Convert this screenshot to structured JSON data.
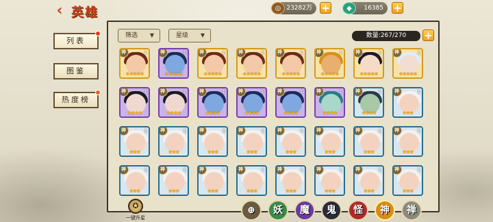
{
  "header": {
    "title": "英雄",
    "back_icon": "chevron-left-icon"
  },
  "currency": {
    "coins": "23282万",
    "jade": "16385",
    "plus_label": "+"
  },
  "sidebar": {
    "items": [
      {
        "label": "列表",
        "active": true,
        "badge": true
      },
      {
        "label": "图鉴",
        "active": false,
        "badge": false
      },
      {
        "label": "热度榜",
        "active": false,
        "badge": true
      }
    ]
  },
  "toolbar": {
    "filter_label": "筛选",
    "sort_label": "星级",
    "count_label": "数量:267/270",
    "add_label": "+"
  },
  "grid": {
    "badge_text": "神",
    "rows": [
      [
        {
          "level": "1",
          "frame": "gold",
          "hair": "#6b2a1a",
          "face": "#f3c9a8",
          "stars": "★★★★★"
        },
        {
          "level": "1",
          "frame": "purple",
          "hair": "#1b2a5a",
          "face": "#7fa8e0",
          "stars": "★★★★★"
        },
        {
          "level": "1",
          "frame": "gold",
          "hair": "#6b2a1a",
          "face": "#f3c9a8",
          "stars": "★★★★★"
        },
        {
          "level": "1",
          "frame": "gold",
          "hair": "#6b2a1a",
          "face": "#f3c9a8",
          "stars": "★★★★★"
        },
        {
          "level": "1",
          "frame": "gold",
          "hair": "#6b2a1a",
          "face": "#f3c9a8",
          "stars": "★★★★★"
        },
        {
          "level": "1",
          "frame": "gold",
          "hair": "#d8901a",
          "face": "#e8b070",
          "stars": "★★★★★"
        },
        {
          "level": "1",
          "frame": "gold",
          "hair": "#1a1a2a",
          "face": "#f6dcc8",
          "stars": "★★★★★"
        },
        {
          "level": "1",
          "frame": "gold",
          "hair": "#e0eef8",
          "face": "#f3dcd0",
          "stars": "★★★★★"
        }
      ],
      [
        {
          "level": "1",
          "frame": "purple",
          "hair": "#1a1a22",
          "face": "#f0d8d0",
          "stars": "★★★★"
        },
        {
          "level": "1",
          "frame": "purple",
          "hair": "#1a1a22",
          "face": "#f0d8d0",
          "stars": "★★★★"
        },
        {
          "level": "1",
          "frame": "purple",
          "hair": "#1b2a5a",
          "face": "#7fa8e0",
          "stars": "★★★★"
        },
        {
          "level": "1",
          "frame": "purple",
          "hair": "#1b2a5a",
          "face": "#7fa8e0",
          "stars": "★★★★"
        },
        {
          "level": "1",
          "frame": "purple",
          "hair": "#1b2a5a",
          "face": "#7fa8e0",
          "stars": "★★★★"
        },
        {
          "level": "1",
          "frame": "purple",
          "hair": "#2a7a8a",
          "face": "#a8d8c8",
          "stars": "★★★★"
        },
        {
          "level": "1",
          "frame": "blue",
          "hair": "#2a3a4a",
          "face": "#a8c8a8",
          "stars": "★★★★"
        },
        {
          "level": "1",
          "frame": "blue",
          "hair": "#f2f2f2",
          "face": "#f3d3c0",
          "stars": "★★★"
        }
      ],
      [
        {
          "level": "1",
          "frame": "blue",
          "hair": "#f2f2f2",
          "face": "#f3d3c0",
          "stars": "★★★"
        },
        {
          "level": "1",
          "frame": "blue",
          "hair": "#f2f2f2",
          "face": "#f3d3c0",
          "stars": "★★★"
        },
        {
          "level": "1",
          "frame": "blue",
          "hair": "#f2f2f2",
          "face": "#f3d3c0",
          "stars": "★★★"
        },
        {
          "level": "1",
          "frame": "blue",
          "hair": "#f2f2f2",
          "face": "#f3d3c0",
          "stars": "★★★"
        },
        {
          "level": "1",
          "frame": "blue",
          "hair": "#f2f2f2",
          "face": "#f3d3c0",
          "stars": "★★★"
        },
        {
          "level": "1",
          "frame": "blue",
          "hair": "#f2f2f2",
          "face": "#f3d3c0",
          "stars": "★★★"
        },
        {
          "level": "1",
          "frame": "blue",
          "hair": "#f2f2f2",
          "face": "#f3d3c0",
          "stars": "★★★"
        },
        {
          "level": "1",
          "frame": "blue",
          "hair": "#f2f2f2",
          "face": "#f3d3c0",
          "stars": "★★★"
        }
      ],
      [
        {
          "level": "1",
          "frame": "blue",
          "hair": "#f2f2f2",
          "face": "#f3d3c0",
          "stars": "★★★"
        },
        {
          "level": "1",
          "frame": "blue",
          "hair": "#f2f2f2",
          "face": "#f3d3c0",
          "stars": "★★★"
        },
        {
          "level": "1",
          "frame": "blue",
          "hair": "#f2f2f2",
          "face": "#f3d3c0",
          "stars": "★★★"
        },
        {
          "level": "1",
          "frame": "blue",
          "hair": "#f2f2f2",
          "face": "#f3d3c0",
          "stars": "★★★"
        },
        {
          "level": "1",
          "frame": "blue",
          "hair": "#f2f2f2",
          "face": "#f3d3c0",
          "stars": "★★★"
        },
        {
          "level": "1",
          "frame": "blue",
          "hair": "#f2f2f2",
          "face": "#f3d3c0",
          "stars": "★★★"
        },
        {
          "level": "1",
          "frame": "blue",
          "hair": "#f2f2f2",
          "face": "#f3d3c0",
          "stars": "★★★"
        },
        {
          "level": "1",
          "frame": "blue",
          "hair": "#f2f2f2",
          "face": "#f3d3c0",
          "stars": "★★★"
        }
      ]
    ]
  },
  "bottom": {
    "upgrade_label": "一键升星",
    "race_tabs": [
      {
        "label": "",
        "name": "all",
        "color": "#6a5a40"
      },
      {
        "label": "妖",
        "name": "yao",
        "color": "#3a8a4a"
      },
      {
        "label": "魔",
        "name": "mo",
        "color": "#6a3aa0"
      },
      {
        "label": "鬼",
        "name": "gui",
        "color": "#2a2a3a"
      },
      {
        "label": "怪",
        "name": "guai",
        "color": "#b02a2a"
      },
      {
        "label": "神",
        "name": "shen",
        "color": "#d88a1a"
      },
      {
        "label": "禅",
        "name": "chan",
        "color": "#8a8a7a"
      }
    ]
  }
}
